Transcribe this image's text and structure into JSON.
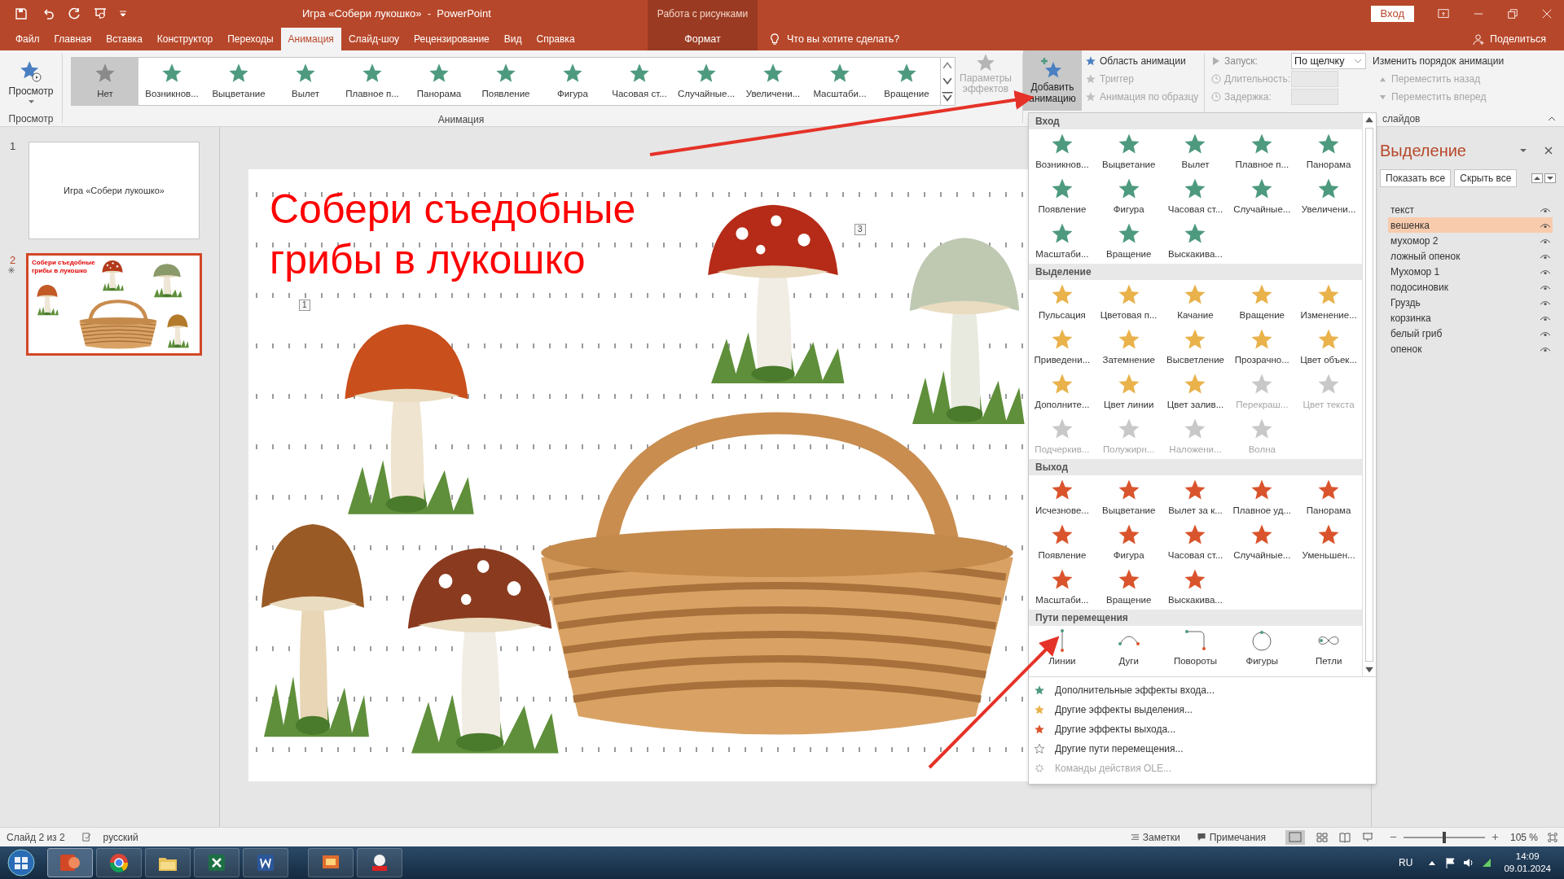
{
  "window": {
    "title": "Игра «Собери лукошко»  -  PowerPoint",
    "context_group": "Работа с рисунками",
    "sign_in": "Вход"
  },
  "tabs": [
    {
      "label": "Файл",
      "selected": false,
      "kind": "normal"
    },
    {
      "label": "Главная",
      "selected": false,
      "kind": "normal"
    },
    {
      "label": "Вставка",
      "selected": false,
      "kind": "normal"
    },
    {
      "label": "Конструктор",
      "selected": false,
      "kind": "normal"
    },
    {
      "label": "Переходы",
      "selected": false,
      "kind": "normal"
    },
    {
      "label": "Анимация",
      "selected": true,
      "kind": "normal"
    },
    {
      "label": "Слайд-шоу",
      "selected": false,
      "kind": "normal"
    },
    {
      "label": "Рецензирование",
      "selected": false,
      "kind": "normal"
    },
    {
      "label": "Вид",
      "selected": false,
      "kind": "normal"
    },
    {
      "label": "Справка",
      "selected": false,
      "kind": "normal"
    },
    {
      "label": "Формат",
      "selected": false,
      "kind": "context"
    }
  ],
  "tell_me": {
    "placeholder": "Что вы хотите сделать?"
  },
  "share": "Поделиться",
  "ribbon": {
    "preview": {
      "label": "Просмотр",
      "group": "Просмотр"
    },
    "gallery": {
      "group": "Анимация",
      "items": [
        {
          "label": "Нет",
          "selected": true
        },
        {
          "label": "Возникнов...",
          "selected": false
        },
        {
          "label": "Выцветание",
          "selected": false
        },
        {
          "label": "Вылет",
          "selected": false
        },
        {
          "label": "Плавное п...",
          "selected": false
        },
        {
          "label": "Панорама",
          "selected": false
        },
        {
          "label": "Появление",
          "selected": false
        },
        {
          "label": "Фигура",
          "selected": false
        },
        {
          "label": "Часовая ст...",
          "selected": false
        },
        {
          "label": "Случайные...",
          "selected": false
        },
        {
          "label": "Увеличени...",
          "selected": false
        },
        {
          "label": "Масштаби...",
          "selected": false
        },
        {
          "label": "Вращение",
          "selected": false
        }
      ]
    },
    "effect_options": {
      "label": "Параметры эффектов",
      "disabled": true
    },
    "add_animation": {
      "label": "Добавить анимацию",
      "selected": true
    },
    "advanced": [
      {
        "label": "Область анимации",
        "disabled": false
      },
      {
        "label": "Триггер",
        "disabled": true
      },
      {
        "label": "Анимация по образцу",
        "disabled": true
      }
    ],
    "timing": [
      {
        "label": "Запуск:",
        "value": "По щелчку",
        "disabled": false,
        "kind": "select"
      },
      {
        "label": "Длительность:",
        "disabled": true,
        "kind": "spin"
      },
      {
        "label": "Задержка:",
        "disabled": true,
        "kind": "spin"
      }
    ],
    "reorder": {
      "title": "Изменить порядок анимации",
      "items": [
        {
          "label": "Переместить назад",
          "disabled": true
        },
        {
          "label": "Переместить вперед",
          "disabled": true
        }
      ]
    },
    "timing_group": "слайдов"
  },
  "slides": [
    {
      "number": "1",
      "selected": false,
      "title": "Игра «Собери лукошко»"
    },
    {
      "number": "2",
      "selected": true,
      "title": "Собери съедобные грибы в лукошко"
    }
  ],
  "slide": {
    "title": "Собери съедобные грибы в лукошко",
    "tags": [
      "1",
      "3"
    ]
  },
  "gallery_dropdown": {
    "sections": [
      {
        "title": "Вход",
        "kind": "entrance",
        "items": [
          {
            "label": "Возникнов...",
            "disabled": false
          },
          {
            "label": "Выцветание",
            "disabled": false
          },
          {
            "label": "Вылет",
            "disabled": false
          },
          {
            "label": "Плавное п...",
            "disabled": false
          },
          {
            "label": "Панорама",
            "disabled": false
          },
          {
            "label": "Появление",
            "disabled": false
          },
          {
            "label": "Фигура",
            "disabled": false
          },
          {
            "label": "Часовая ст...",
            "disabled": false
          },
          {
            "label": "Случайные...",
            "disabled": false
          },
          {
            "label": "Увеличени...",
            "disabled": false
          },
          {
            "label": "Масштаби...",
            "disabled": false
          },
          {
            "label": "Вращение",
            "disabled": false
          },
          {
            "label": "Выскакива...",
            "disabled": false
          }
        ]
      },
      {
        "title": "Выделение",
        "kind": "emphasis",
        "items": [
          {
            "label": "Пульсация",
            "disabled": false
          },
          {
            "label": "Цветовая п...",
            "disabled": false
          },
          {
            "label": "Качание",
            "disabled": false
          },
          {
            "label": "Вращение",
            "disabled": false
          },
          {
            "label": "Изменение...",
            "disabled": false
          },
          {
            "label": "Приведени...",
            "disabled": false
          },
          {
            "label": "Затемнение",
            "disabled": false
          },
          {
            "label": "Высветление",
            "disabled": false
          },
          {
            "label": "Прозрачно...",
            "disabled": false
          },
          {
            "label": "Цвет объек...",
            "disabled": false
          },
          {
            "label": "Дополните...",
            "disabled": false
          },
          {
            "label": "Цвет линии",
            "disabled": false
          },
          {
            "label": "Цвет залив...",
            "disabled": false
          },
          {
            "label": "Перекраш...",
            "disabled": true
          },
          {
            "label": "Цвет текста",
            "disabled": true
          },
          {
            "label": "Подчеркив...",
            "disabled": true
          },
          {
            "label": "Полужирн...",
            "disabled": true
          },
          {
            "label": "Наложени...",
            "disabled": true
          },
          {
            "label": "Волна",
            "disabled": true
          }
        ]
      },
      {
        "title": "Выход",
        "kind": "exit",
        "items": [
          {
            "label": "Исчезнове...",
            "disabled": false
          },
          {
            "label": "Выцветание",
            "disabled": false
          },
          {
            "label": "Вылет за к...",
            "disabled": false
          },
          {
            "label": "Плавное уд...",
            "disabled": false
          },
          {
            "label": "Панорама",
            "disabled": false
          },
          {
            "label": "Появление",
            "disabled": false
          },
          {
            "label": "Фигура",
            "disabled": false
          },
          {
            "label": "Часовая ст...",
            "disabled": false
          },
          {
            "label": "Случайные...",
            "disabled": false
          },
          {
            "label": "Уменьшен...",
            "disabled": false
          },
          {
            "label": "Масштаби...",
            "disabled": false
          },
          {
            "label": "Вращение",
            "disabled": false
          },
          {
            "label": "Выскакива...",
            "disabled": false
          }
        ]
      },
      {
        "title": "Пути перемещения",
        "kind": "path",
        "items": [
          {
            "label": "Линии",
            "kind": "line",
            "disabled": false
          },
          {
            "label": "Дуги",
            "kind": "arc",
            "disabled": false
          },
          {
            "label": "Повороты",
            "kind": "turn",
            "disabled": false
          },
          {
            "label": "Фигуры",
            "kind": "circle",
            "disabled": false
          },
          {
            "label": "Петли",
            "kind": "loop",
            "disabled": false
          }
        ]
      }
    ],
    "links": [
      {
        "label": "Дополнительные эффекты входа...",
        "kind": "entrance",
        "disabled": false
      },
      {
        "label": "Другие эффекты выделения...",
        "kind": "emphasis",
        "disabled": false
      },
      {
        "label": "Другие эффекты выхода...",
        "kind": "exit",
        "disabled": false
      },
      {
        "label": "Другие пути перемещения...",
        "kind": "path",
        "disabled": false
      },
      {
        "label": "Команды действия OLE...",
        "kind": "ole",
        "disabled": true
      }
    ]
  },
  "selection_pane": {
    "title": "Выделение",
    "buttons": [
      "Показать все",
      "Скрыть все"
    ],
    "items": [
      {
        "label": "текст",
        "selected": false
      },
      {
        "label": "вешенка",
        "selected": true
      },
      {
        "label": "мухомор 2",
        "selected": false
      },
      {
        "label": "ложный опенок",
        "selected": false
      },
      {
        "label": "Мухомор 1",
        "selected": false
      },
      {
        "label": "подосиновик",
        "selected": false
      },
      {
        "label": "Груздь",
        "selected": false
      },
      {
        "label": "корзинка",
        "selected": false
      },
      {
        "label": "белый гриб",
        "selected": false
      },
      {
        "label": "опенок",
        "selected": false
      }
    ]
  },
  "status_bar": {
    "slide": "Слайд 2 из 2",
    "language": "русский",
    "notes": "Заметки",
    "comments": "Примечания",
    "zoom": "105 %",
    "zoom_slider": {
      "level": 0.5
    }
  },
  "taskbar": {
    "language": "RU",
    "time": "14:09",
    "date": "09.01.2024"
  }
}
